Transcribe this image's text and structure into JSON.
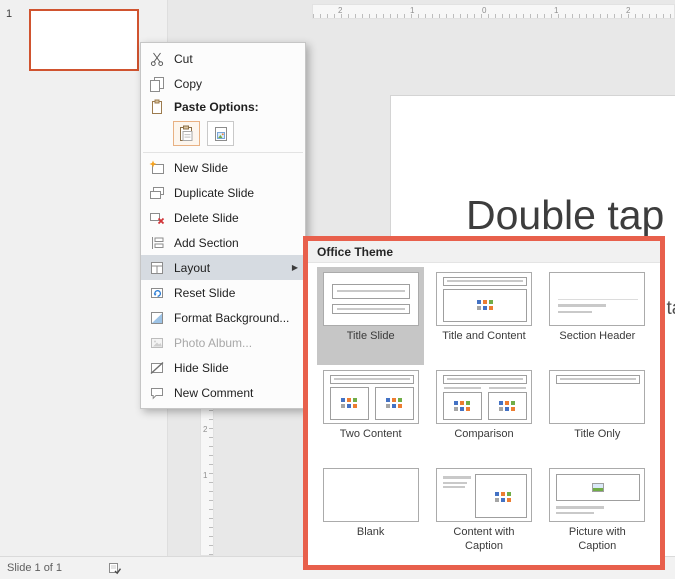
{
  "thumbnail_panel": {
    "slide_number": "1"
  },
  "ruler": {
    "h": [
      "2",
      "1",
      "0",
      "1",
      "2"
    ],
    "v": [
      "2",
      "1"
    ]
  },
  "slide": {
    "title_placeholder": "Double tap to add title",
    "subtitle_placeholder": "Double tap to add subtitle"
  },
  "context_menu": {
    "cut": "Cut",
    "copy": "Copy",
    "paste_options": "Paste Options:",
    "new_slide": "New Slide",
    "duplicate_slide": "Duplicate Slide",
    "delete_slide": "Delete Slide",
    "add_section": "Add Section",
    "layout": "Layout",
    "reset_slide": "Reset Slide",
    "format_background": "Format Background...",
    "photo_album": "Photo Album...",
    "hide_slide": "Hide Slide",
    "new_comment": "New Comment",
    "submenu_arrow": "▶"
  },
  "layout_submenu": {
    "title": "Office Theme",
    "selected": "Title Slide",
    "layouts": [
      "Title Slide",
      "Title and Content",
      "Section Header",
      "Two Content",
      "Comparison",
      "Title Only",
      "Blank",
      "Content with Caption",
      "Picture with Caption"
    ]
  },
  "status_bar": {
    "text": "Slide 1 of 1"
  },
  "colors": {
    "annotation_red": "#e8604c",
    "thumbnail_selection": "#d0532f",
    "menu_highlight": "#d6dbe1",
    "selected_layout_bg": "#c6c6c6",
    "content_icon_blue": "#4472c4",
    "content_icon_orange": "#ed7d31",
    "content_icon_green": "#70ad47"
  }
}
